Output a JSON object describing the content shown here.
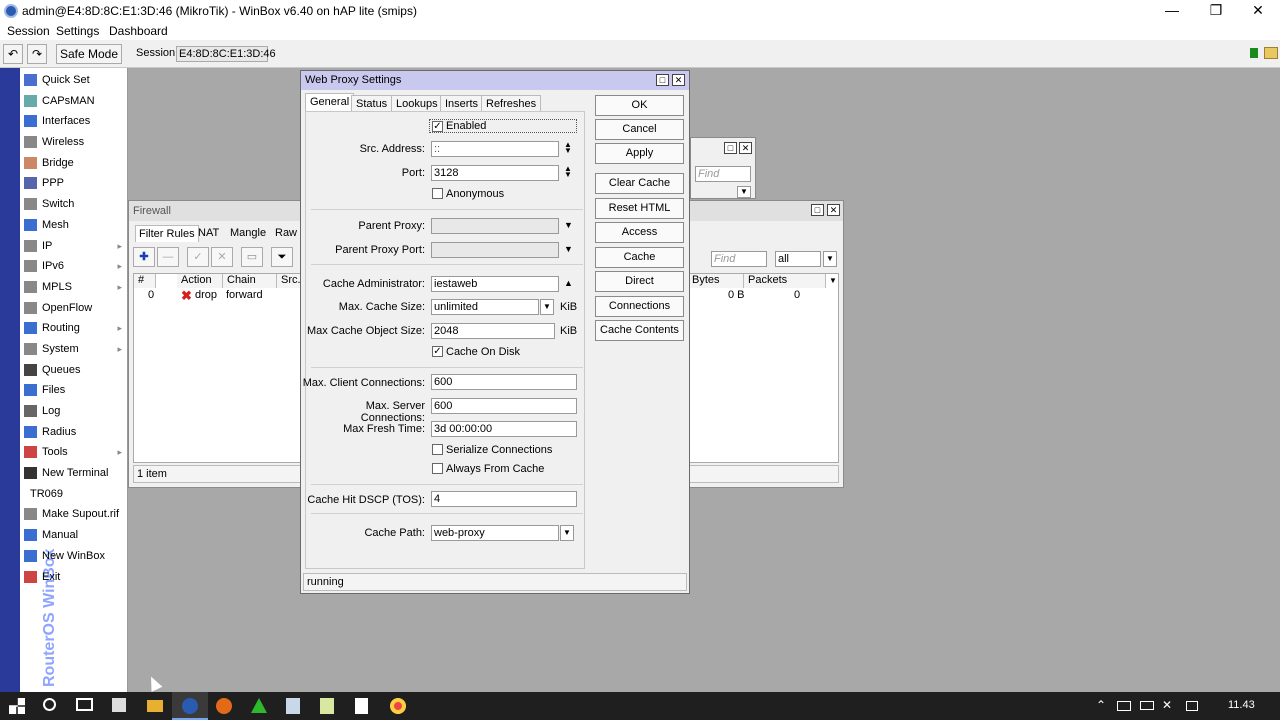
{
  "window": {
    "title": "admin@E4:8D:8C:E1:3D:46 (MikroTik) - WinBox v6.40 on hAP lite (smips)",
    "minimize": "—",
    "restore": "❐",
    "close": "✕"
  },
  "menu": {
    "items": [
      "Session",
      "Settings",
      "Dashboard"
    ]
  },
  "toolbar": {
    "undo": "↶",
    "redo": "↷",
    "safe_mode": "Safe Mode",
    "session_label": "Session:",
    "session_value": "E4:8D:8C:E1:3D:46"
  },
  "sidebar": {
    "brand": "RouterOS WinBox",
    "items": [
      {
        "label": "Quick Set",
        "icon": "quick-set-icon",
        "submenu": false
      },
      {
        "label": "CAPsMAN",
        "icon": "capsman-icon",
        "submenu": false
      },
      {
        "label": "Interfaces",
        "icon": "interfaces-icon",
        "submenu": false
      },
      {
        "label": "Wireless",
        "icon": "wireless-icon",
        "submenu": false
      },
      {
        "label": "Bridge",
        "icon": "bridge-icon",
        "submenu": false
      },
      {
        "label": "PPP",
        "icon": "ppp-icon",
        "submenu": false
      },
      {
        "label": "Switch",
        "icon": "switch-icon",
        "submenu": false
      },
      {
        "label": "Mesh",
        "icon": "mesh-icon",
        "submenu": false
      },
      {
        "label": "IP",
        "icon": "ip-icon",
        "submenu": true
      },
      {
        "label": "IPv6",
        "icon": "ipv6-icon",
        "submenu": true
      },
      {
        "label": "MPLS",
        "icon": "mpls-icon",
        "submenu": true
      },
      {
        "label": "OpenFlow",
        "icon": "openflow-icon",
        "submenu": false
      },
      {
        "label": "Routing",
        "icon": "routing-icon",
        "submenu": true
      },
      {
        "label": "System",
        "icon": "system-icon",
        "submenu": true
      },
      {
        "label": "Queues",
        "icon": "queues-icon",
        "submenu": false
      },
      {
        "label": "Files",
        "icon": "files-icon",
        "submenu": false
      },
      {
        "label": "Log",
        "icon": "log-icon",
        "submenu": false
      },
      {
        "label": "Radius",
        "icon": "radius-icon",
        "submenu": false
      },
      {
        "label": "Tools",
        "icon": "tools-icon",
        "submenu": true
      },
      {
        "label": "New Terminal",
        "icon": "terminal-icon",
        "submenu": false
      },
      {
        "label": "TR069",
        "icon": "",
        "submenu": false
      },
      {
        "label": "Make Supout.rif",
        "icon": "supout-icon",
        "submenu": false
      },
      {
        "label": "Manual",
        "icon": "manual-icon",
        "submenu": false
      },
      {
        "label": "New WinBox",
        "icon": "winbox-icon",
        "submenu": false
      },
      {
        "label": "Exit",
        "icon": "exit-icon",
        "submenu": false
      }
    ],
    "submenu_arrow": "▸"
  },
  "firewall": {
    "title": "Firewall",
    "tabs": [
      "Filter Rules",
      "NAT",
      "Mangle",
      "Raw"
    ],
    "toolbar": {
      "add": "✚",
      "remove": "—",
      "enable": "✓",
      "disable": "✕",
      "comment": "▭",
      "filter": "⏷"
    },
    "find_placeholder": "Find",
    "filter_select": "all",
    "columns": [
      "#",
      "Action",
      "Chain",
      "Src.",
      "Bytes",
      "Packets"
    ],
    "rows": [
      {
        "num": "0",
        "action": "drop",
        "chain": "forward",
        "bytes": "0 B",
        "packets": "0"
      }
    ],
    "status": "1 item"
  },
  "backwin": {
    "find_placeholder": "Find"
  },
  "dialog": {
    "title": "Web Proxy Settings",
    "tabs": [
      "General",
      "Status",
      "Lookups",
      "Inserts",
      "Refreshes"
    ],
    "enabled": {
      "label": "Enabled",
      "checked": true
    },
    "src_address": {
      "label": "Src. Address:",
      "value": "::"
    },
    "port": {
      "label": "Port:",
      "value": "3128"
    },
    "anonymous": {
      "label": "Anonymous",
      "checked": false
    },
    "parent_proxy": {
      "label": "Parent Proxy:",
      "value": ""
    },
    "parent_proxy_port": {
      "label": "Parent Proxy Port:",
      "value": ""
    },
    "cache_admin": {
      "label": "Cache Administrator:",
      "value": "iestaweb"
    },
    "max_cache_size": {
      "label": "Max. Cache Size:",
      "value": "unlimited",
      "unit": "KiB"
    },
    "max_cache_object_size": {
      "label": "Max Cache Object Size:",
      "value": "2048",
      "unit": "KiB"
    },
    "cache_on_disk": {
      "label": "Cache On Disk",
      "checked": true
    },
    "max_client_conn": {
      "label": "Max. Client Connections:",
      "value": "600"
    },
    "max_server_conn": {
      "label": "Max. Server Connections:",
      "value": "600"
    },
    "max_fresh_time": {
      "label": "Max Fresh Time:",
      "value": "3d 00:00:00"
    },
    "serialize_conn": {
      "label": "Serialize Connections",
      "checked": false
    },
    "always_from_cache": {
      "label": "Always From Cache",
      "checked": false
    },
    "cache_hit_dscp": {
      "label": "Cache Hit DSCP (TOS):",
      "value": "4"
    },
    "cache_path": {
      "label": "Cache Path:",
      "value": "web-proxy"
    },
    "buttons": [
      "OK",
      "Cancel",
      "Apply",
      "Clear Cache",
      "Reset HTML",
      "Access",
      "Cache",
      "Direct",
      "Connections",
      "Cache Contents"
    ],
    "status": "running",
    "check_mark": "✓",
    "spin_up": "▲",
    "spin_down": "▼",
    "dropdown": "▼"
  },
  "taskbar": {
    "clock": "11.43"
  },
  "colors": {
    "sidebar_strip": "#2a3a9a",
    "dialog_title": "#c9c9f0",
    "drop_icon": "#d42020",
    "add_icon": "#1a3fb0"
  }
}
